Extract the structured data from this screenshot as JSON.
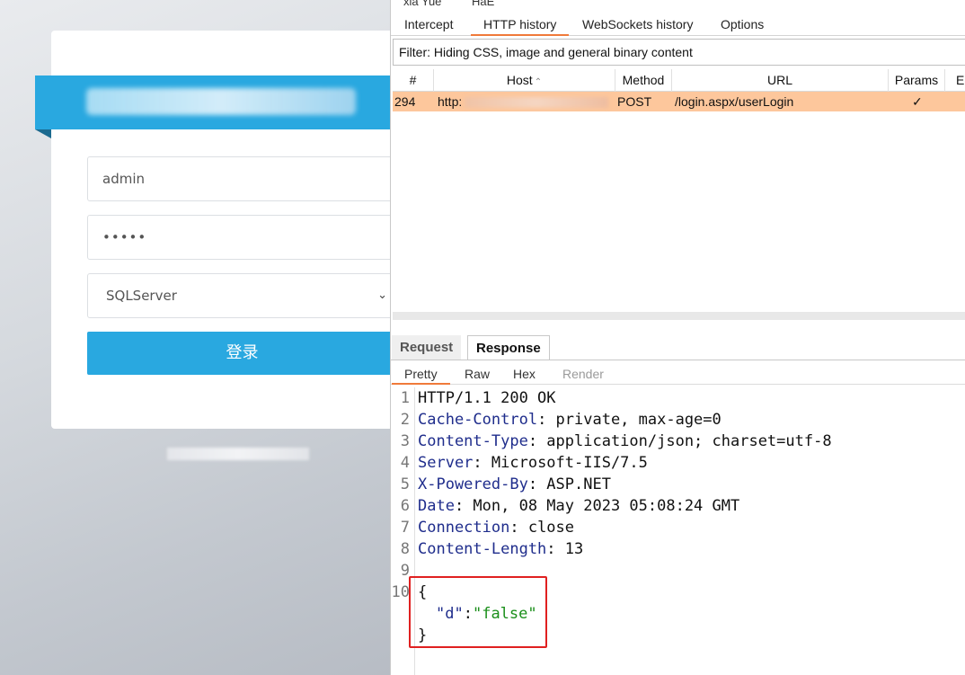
{
  "login": {
    "username": "admin",
    "password_mask": "•••••",
    "database": "SQLServer",
    "submit_label": "登录"
  },
  "burp": {
    "ext_tabs": [
      "xia Yue",
      "HaE"
    ],
    "main_tabs": [
      "Intercept",
      "HTTP history",
      "WebSockets history",
      "Options"
    ],
    "filter_text": "Filter: Hiding CSS, image and general binary content",
    "columns": [
      "#",
      "Host",
      "Method",
      "URL",
      "Params",
      "Ed"
    ],
    "row": {
      "num": "294",
      "host": "http:",
      "method": "POST",
      "url": "/login.aspx/userLogin",
      "params": "✓"
    },
    "rr_tabs": [
      "Request",
      "Response"
    ],
    "view_tabs": [
      "Pretty",
      "Raw",
      "Hex",
      "Render"
    ],
    "response": {
      "line_numbers": [
        "1",
        "2",
        "3",
        "4",
        "5",
        "6",
        "7",
        "8",
        "9",
        "10"
      ],
      "status": "HTTP/1.1 200 OK",
      "headers": [
        {
          "name": "Cache-Control",
          "value": ": private, max-age=0"
        },
        {
          "name": "Content-Type",
          "value": ": application/json; charset=utf-8"
        },
        {
          "name": "Server",
          "value": ": Microsoft-IIS/7.5"
        },
        {
          "name": "X-Powered-By",
          "value": ": ASP.NET"
        },
        {
          "name": "Date",
          "value": ": Mon, 08 May 2023 05:08:24 GMT"
        },
        {
          "name": "Connection",
          "value": ": close"
        },
        {
          "name": "Content-Length",
          "value": ": 13"
        }
      ],
      "body_open": "{",
      "body_key": "\"d\"",
      "body_colon": ":",
      "body_value": "\"false\"",
      "body_close": "}"
    },
    "colors": {
      "accent": "#f07a3a",
      "selected_row": "#fdc79c",
      "highlight_box": "#e02020"
    }
  }
}
